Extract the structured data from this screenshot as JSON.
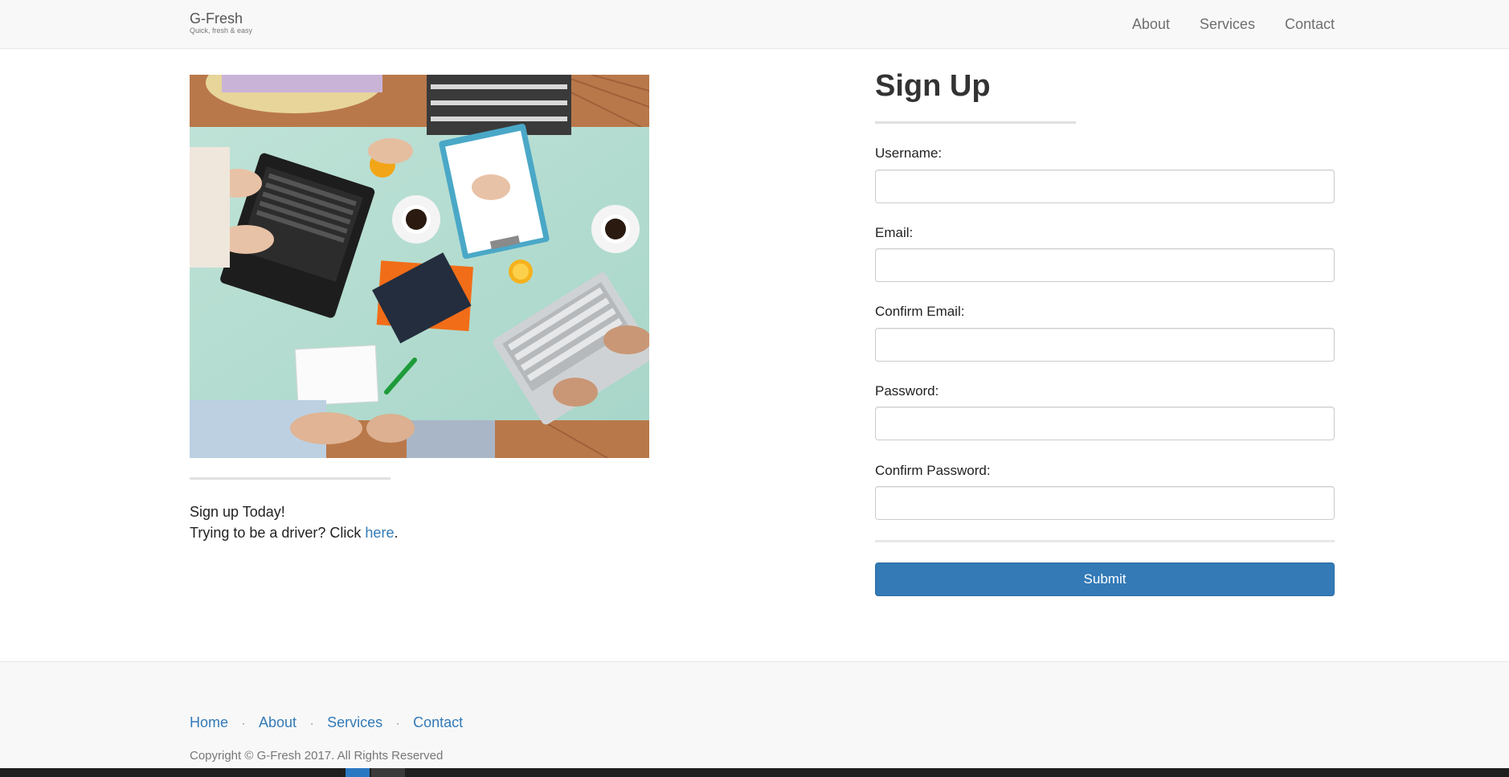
{
  "navbar": {
    "brand": "G-Fresh",
    "tagline": "Quick, fresh & easy",
    "links": [
      "About",
      "Services",
      "Contact"
    ]
  },
  "hero": {
    "image_description": "overhead-photo-team-working-at-table"
  },
  "promo": {
    "line1": "Sign up Today!",
    "line2_prefix": "Trying to be a driver? Click ",
    "line2_link": "here",
    "line2_suffix": "."
  },
  "form": {
    "title": "Sign Up",
    "fields": [
      {
        "label": "Username:",
        "value": "",
        "placeholder": ""
      },
      {
        "label": "Email:",
        "value": "",
        "placeholder": ""
      },
      {
        "label": "Confirm Email:",
        "value": "",
        "placeholder": ""
      },
      {
        "label": "Password:",
        "value": "",
        "placeholder": ""
      },
      {
        "label": "Confirm Password:",
        "value": "",
        "placeholder": ""
      }
    ],
    "submit_label": "Submit"
  },
  "footer": {
    "links": [
      "Home",
      "About",
      "Services",
      "Contact"
    ],
    "separator": "·",
    "copyright": "Copyright © G-Fresh 2017. All Rights Reserved"
  },
  "colors": {
    "primary": "#337ab7",
    "navbar_bg": "#f8f8f8",
    "text": "#222222"
  }
}
